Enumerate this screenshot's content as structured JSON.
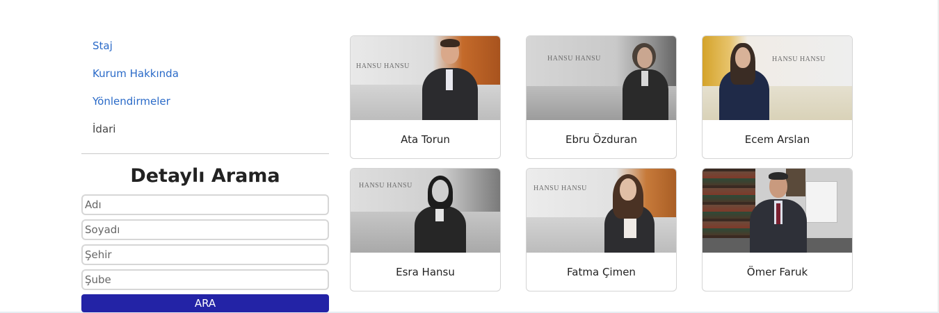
{
  "sidebar": {
    "links": [
      {
        "label": "Staj"
      },
      {
        "label": "Kurum Hakkında"
      },
      {
        "label": "Yönlendirmeler"
      },
      {
        "label": "İdari"
      }
    ]
  },
  "search": {
    "title": "Detaylı Arama",
    "fields": [
      {
        "placeholder": "Adı"
      },
      {
        "placeholder": "Soyadı"
      },
      {
        "placeholder": "Şehir"
      },
      {
        "placeholder": "Şube"
      }
    ],
    "button_label": "ARA"
  },
  "people": [
    {
      "name": "Ata Torun",
      "logo": "HANSU HANSU"
    },
    {
      "name": "Ebru Özduran",
      "logo": "HANSU HANSU"
    },
    {
      "name": "Ecem Arslan",
      "logo": "HANSU HANSU"
    },
    {
      "name": "Esra Hansu",
      "logo": "HANSU HANSU"
    },
    {
      "name": "Fatma Çimen",
      "logo": "HANSU HANSU"
    },
    {
      "name": "Ömer Faruk"
    }
  ]
}
